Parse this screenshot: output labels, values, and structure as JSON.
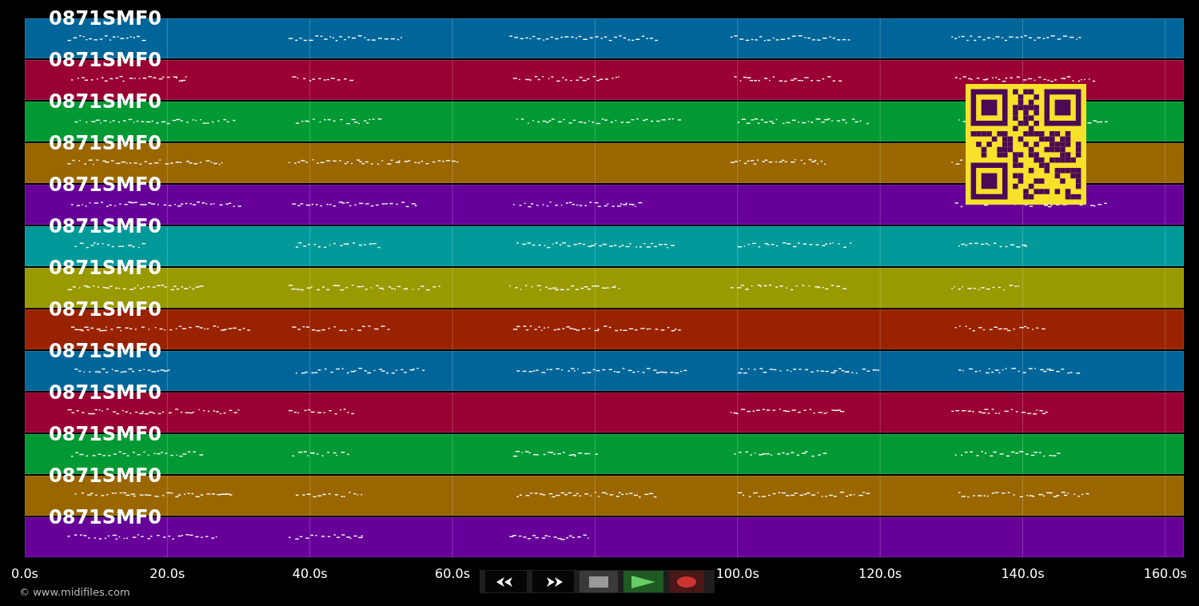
{
  "tracks": [
    {
      "label": "0871SMF0",
      "color": "#006699"
    },
    {
      "label": "0871SMF0",
      "color": "#990033"
    },
    {
      "label": "0871SMF0",
      "color": "#009933"
    },
    {
      "label": "0871SMF0",
      "color": "#996600"
    },
    {
      "label": "0871SMF0",
      "color": "#660099"
    },
    {
      "label": "0871SMF0",
      "color": "#009999"
    },
    {
      "label": "0871SMF0",
      "color": "#999900"
    },
    {
      "label": "0871SMF0",
      "color": "#992200"
    },
    {
      "label": "0871SMF0",
      "color": "#006699"
    },
    {
      "label": "0871SMF0",
      "color": "#990033"
    },
    {
      "label": "0871SMF0",
      "color": "#009933"
    },
    {
      "label": "0871SMF0",
      "color": "#996600"
    },
    {
      "label": "0871SMF0",
      "color": "#660099"
    }
  ],
  "time_axis": [
    "0.0s",
    "20.0s",
    "40.0s",
    "60.0s",
    "100.0s",
    "120.0s",
    "140.0s",
    "160.0s"
  ],
  "transport": [
    {
      "kind": "rewind"
    },
    {
      "kind": "forward"
    },
    {
      "kind": "stop"
    },
    {
      "kind": "play"
    },
    {
      "kind": "record"
    }
  ],
  "copyright": "© www.midifiles.com"
}
